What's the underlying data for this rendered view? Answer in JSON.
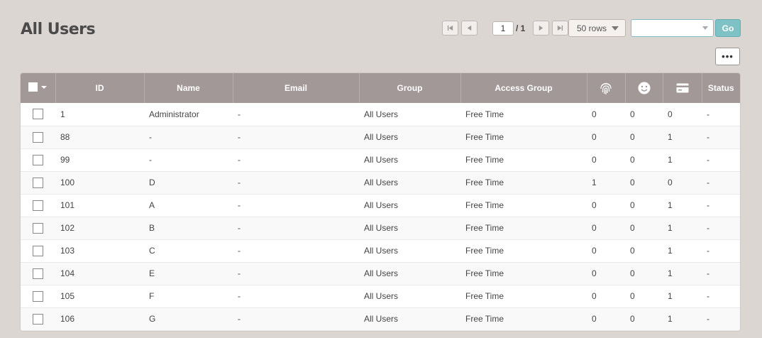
{
  "page": {
    "title": "All Users"
  },
  "pager": {
    "current": "1",
    "total": "/ 1"
  },
  "rows_select": {
    "label": "50 rows"
  },
  "search": {
    "value": "",
    "placeholder": ""
  },
  "go_label": "Go",
  "more_label": "•••",
  "table": {
    "headers": {
      "id": "ID",
      "name": "Name",
      "email": "Email",
      "group": "Group",
      "access_group": "Access Group",
      "fingerprint": "fingerprint-icon",
      "face": "face-icon",
      "card": "card-icon",
      "status": "Status"
    },
    "rows": [
      {
        "id": "1",
        "name": "Administrator",
        "email": "-",
        "group": "All Users",
        "access_group": "Free Time",
        "fingerprint": "0",
        "face": "0",
        "card": "0",
        "status": "-"
      },
      {
        "id": "88",
        "name": "-",
        "email": "-",
        "group": "All Users",
        "access_group": "Free Time",
        "fingerprint": "0",
        "face": "0",
        "card": "1",
        "status": "-"
      },
      {
        "id": "99",
        "name": "-",
        "email": "-",
        "group": "All Users",
        "access_group": "Free Time",
        "fingerprint": "0",
        "face": "0",
        "card": "1",
        "status": "-"
      },
      {
        "id": "100",
        "name": "D",
        "email": "-",
        "group": "All Users",
        "access_group": "Free Time",
        "fingerprint": "1",
        "face": "0",
        "card": "0",
        "status": "-"
      },
      {
        "id": "101",
        "name": "A",
        "email": "-",
        "group": "All Users",
        "access_group": "Free Time",
        "fingerprint": "0",
        "face": "0",
        "card": "1",
        "status": "-"
      },
      {
        "id": "102",
        "name": "B",
        "email": "-",
        "group": "All Users",
        "access_group": "Free Time",
        "fingerprint": "0",
        "face": "0",
        "card": "1",
        "status": "-"
      },
      {
        "id": "103",
        "name": "C",
        "email": "-",
        "group": "All Users",
        "access_group": "Free Time",
        "fingerprint": "0",
        "face": "0",
        "card": "1",
        "status": "-"
      },
      {
        "id": "104",
        "name": "E",
        "email": "-",
        "group": "All Users",
        "access_group": "Free Time",
        "fingerprint": "0",
        "face": "0",
        "card": "1",
        "status": "-"
      },
      {
        "id": "105",
        "name": "F",
        "email": "-",
        "group": "All Users",
        "access_group": "Free Time",
        "fingerprint": "0",
        "face": "0",
        "card": "1",
        "status": "-"
      },
      {
        "id": "106",
        "name": "G",
        "email": "-",
        "group": "All Users",
        "access_group": "Free Time",
        "fingerprint": "0",
        "face": "0",
        "card": "1",
        "status": "-"
      }
    ]
  },
  "colors": {
    "header_bg": "#a39898",
    "accent": "#7fc2c6",
    "page_bg": "#dcd6d2"
  }
}
